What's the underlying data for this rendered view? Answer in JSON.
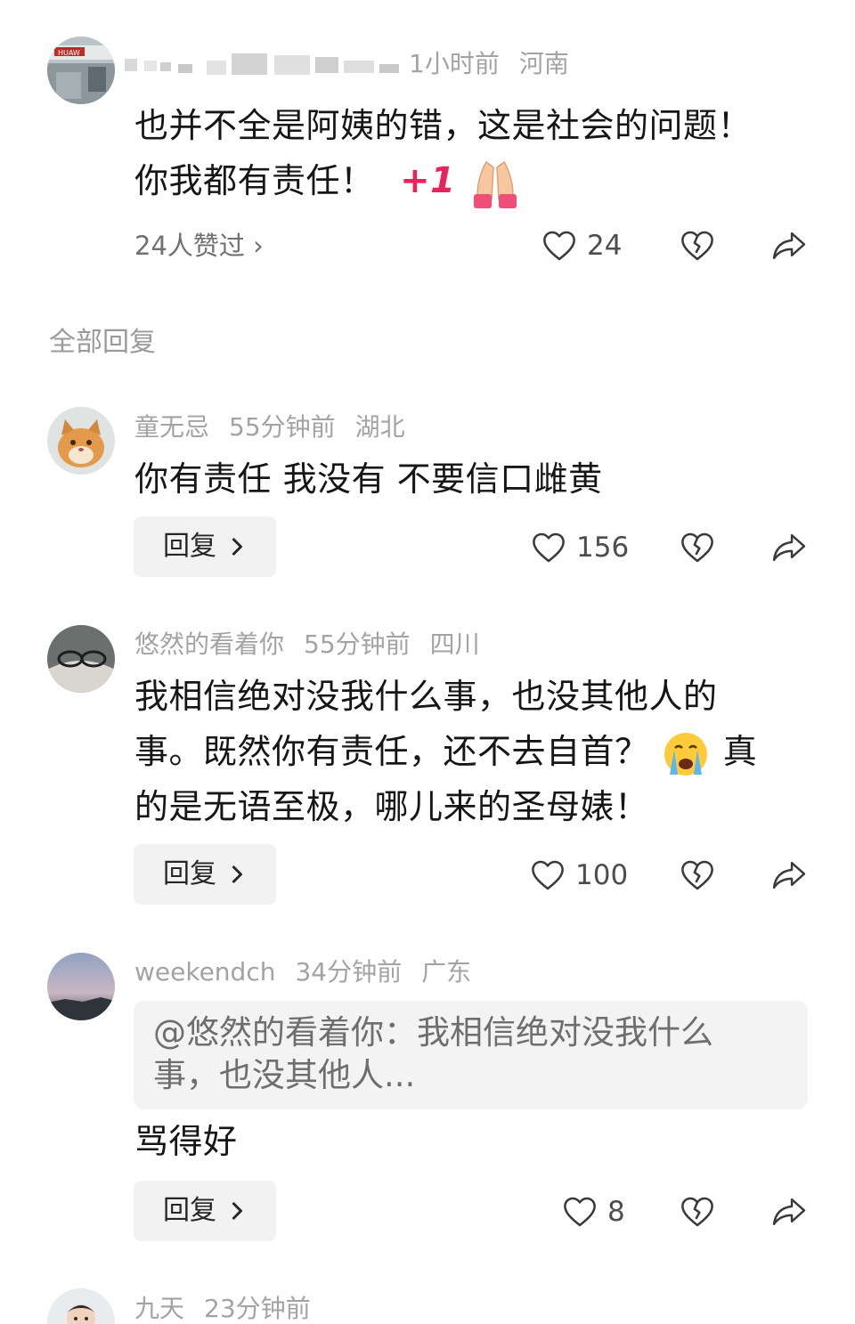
{
  "colors": {
    "text": "#161616",
    "meta": "#a3a3a3",
    "icon": "#3a3a3a",
    "reply_bg": "#f2f2f2",
    "plus_one": "#e8245c"
  },
  "top_comment": {
    "time": "1小时前",
    "location": "河南",
    "text_line1": "也并不全是阿姨的错，这是社会的问题！",
    "text_line2": "你我都有责任！",
    "plus_one": "+1",
    "emoji": "folded-hands-emoji",
    "liked_by": "24人赞过 ›",
    "likes": "24"
  },
  "section_title": "全部回复",
  "replies": [
    {
      "username": "童无忌",
      "time": "55分钟前",
      "location": "湖北",
      "text": "你有责任 我没有 不要信口雌黄",
      "reply_label": "回复",
      "likes": "156"
    },
    {
      "username": "悠然的看着你",
      "time": "55分钟前",
      "location": "四川",
      "text_line1": "我相信绝对没我什么事，也没其他人的",
      "text_line2a": "事。既然你有责任，还不去自首？",
      "text_line2b": "真",
      "text_line3": "的是无语至极，哪儿来的圣母婊！",
      "emoji": "loudly-crying-face-emoji",
      "reply_label": "回复",
      "likes": "100"
    },
    {
      "username": "weekendch",
      "time": "34分钟前",
      "location": "广东",
      "quote_line1": "@悠然的看着你：我相信绝对没我什么",
      "quote_line2": "事，也没其他人...",
      "text": "骂得好",
      "reply_label": "回复",
      "likes": "8"
    },
    {
      "username": "九天",
      "time": "23分钟前"
    }
  ]
}
